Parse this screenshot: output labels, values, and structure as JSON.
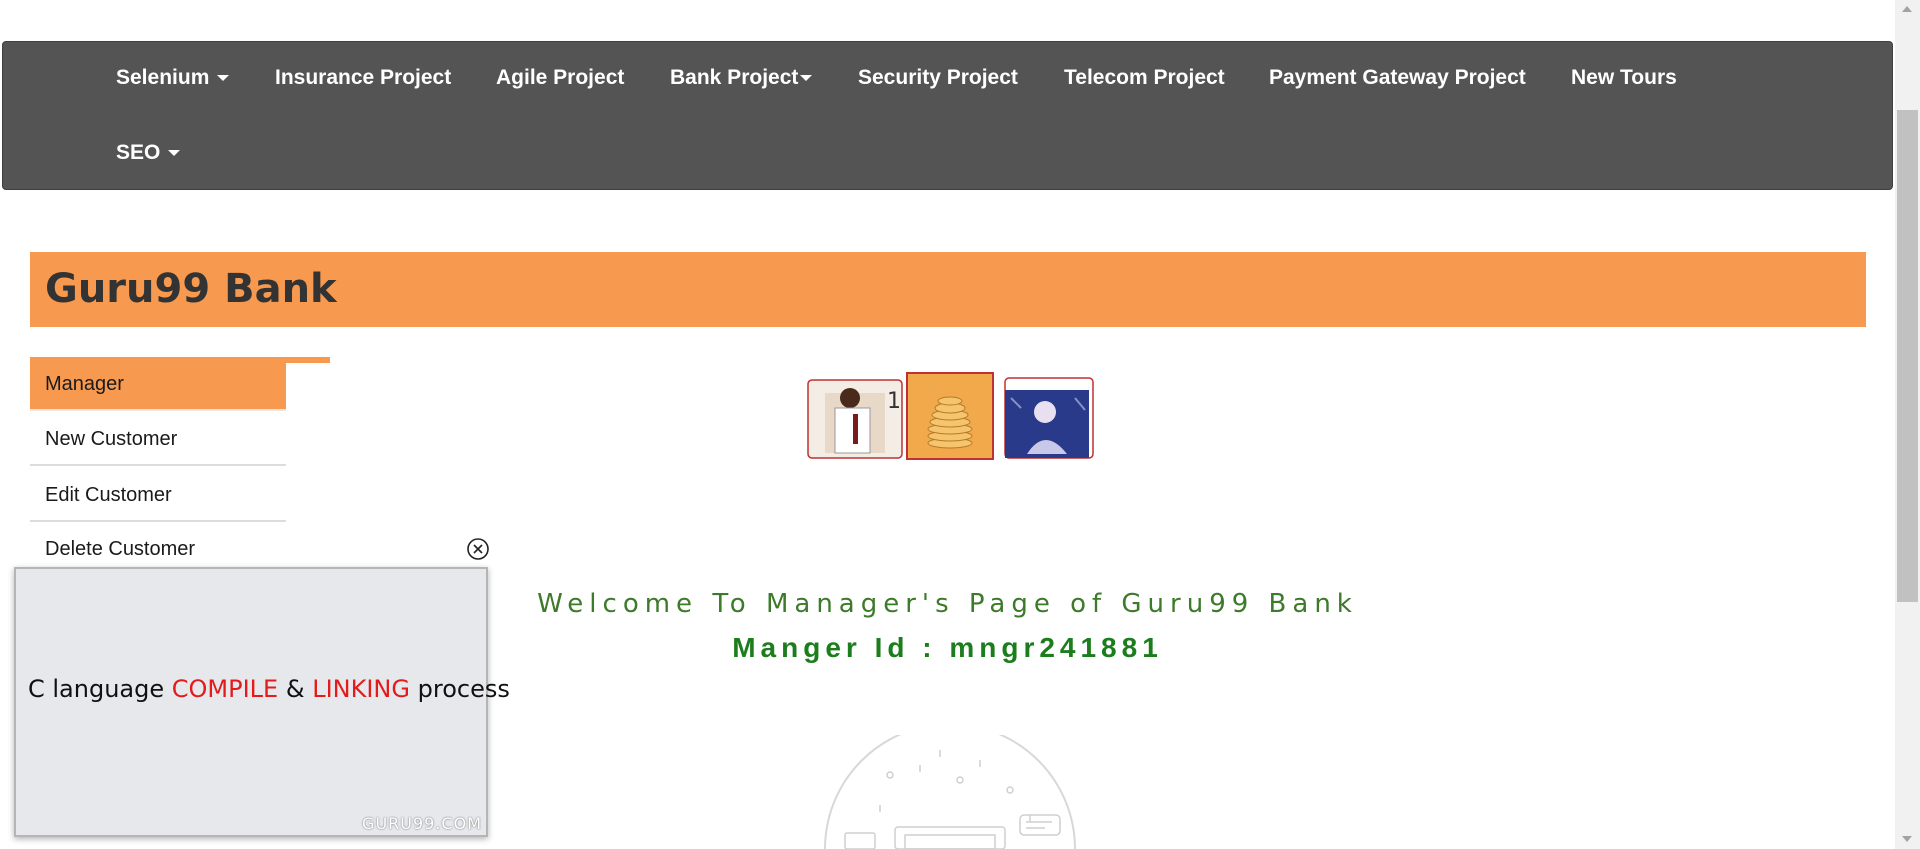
{
  "nav": {
    "selenium": "Selenium",
    "insurance": "Insurance Project",
    "agile": "Agile Project",
    "bank": "Bank Project",
    "security": "Security Project",
    "telecom": "Telecom Project",
    "payment": "Payment Gateway Project",
    "tours": "New Tours",
    "seo": "SEO"
  },
  "brand": {
    "title": "Guru99 Bank"
  },
  "menu": {
    "items": [
      {
        "label": "Manager"
      },
      {
        "label": "New Customer"
      },
      {
        "label": "Edit Customer"
      },
      {
        "label": "Delete Customer"
      }
    ]
  },
  "main": {
    "welcome": "Welcome To Manager's Page of Guru99 Bank",
    "manager_id": "Manger Id : mngr241881"
  },
  "ad": {
    "text_part1": "C language ",
    "text_part2": "COMPILE",
    "text_part3": " & ",
    "text_part4": "LINKING",
    "text_part5": " process",
    "watermark": "GURU99.COM"
  },
  "colors": {
    "nav_bg": "#545454",
    "brand_orange": "#f79a50",
    "welcome_green": "#3d7a2a",
    "ad_red": "#e31b1b"
  }
}
